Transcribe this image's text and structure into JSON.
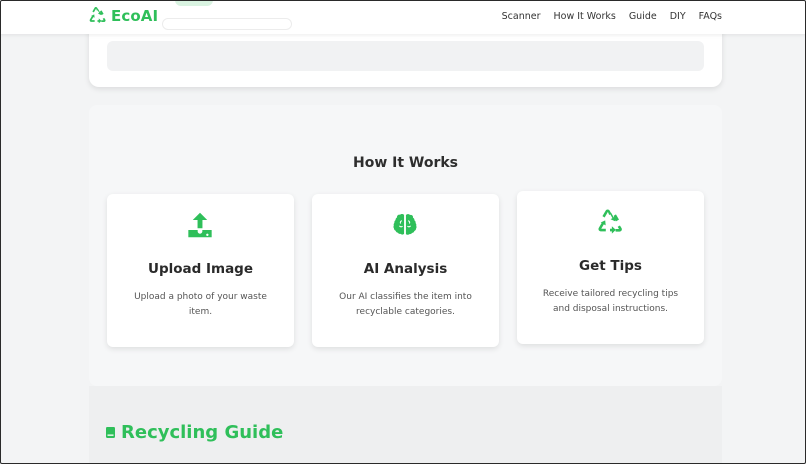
{
  "brand": {
    "name": "EcoAI",
    "color": "#2fbf5a",
    "icon": "recycle-icon"
  },
  "nav": {
    "items": [
      {
        "label": "Scanner"
      },
      {
        "label": "How It Works"
      },
      {
        "label": "Guide"
      },
      {
        "label": "DIY"
      },
      {
        "label": "FAQs"
      }
    ]
  },
  "how_it_works": {
    "title": "How It Works",
    "steps": [
      {
        "icon": "upload-icon",
        "title": "Upload Image",
        "description": "Upload a photo of your waste item."
      },
      {
        "icon": "brain-icon",
        "title": "AI Analysis",
        "description": "Our AI classifies the item into recyclable categories."
      },
      {
        "icon": "recycle-icon",
        "title": "Get Tips",
        "description": "Receive tailored recycling tips and disposal instructions."
      }
    ]
  },
  "guide": {
    "title": "Recycling Guide",
    "icon": "book-icon"
  },
  "colors": {
    "accent": "#2fbf5a",
    "background": "#f3f4f5",
    "card": "#ffffff"
  }
}
